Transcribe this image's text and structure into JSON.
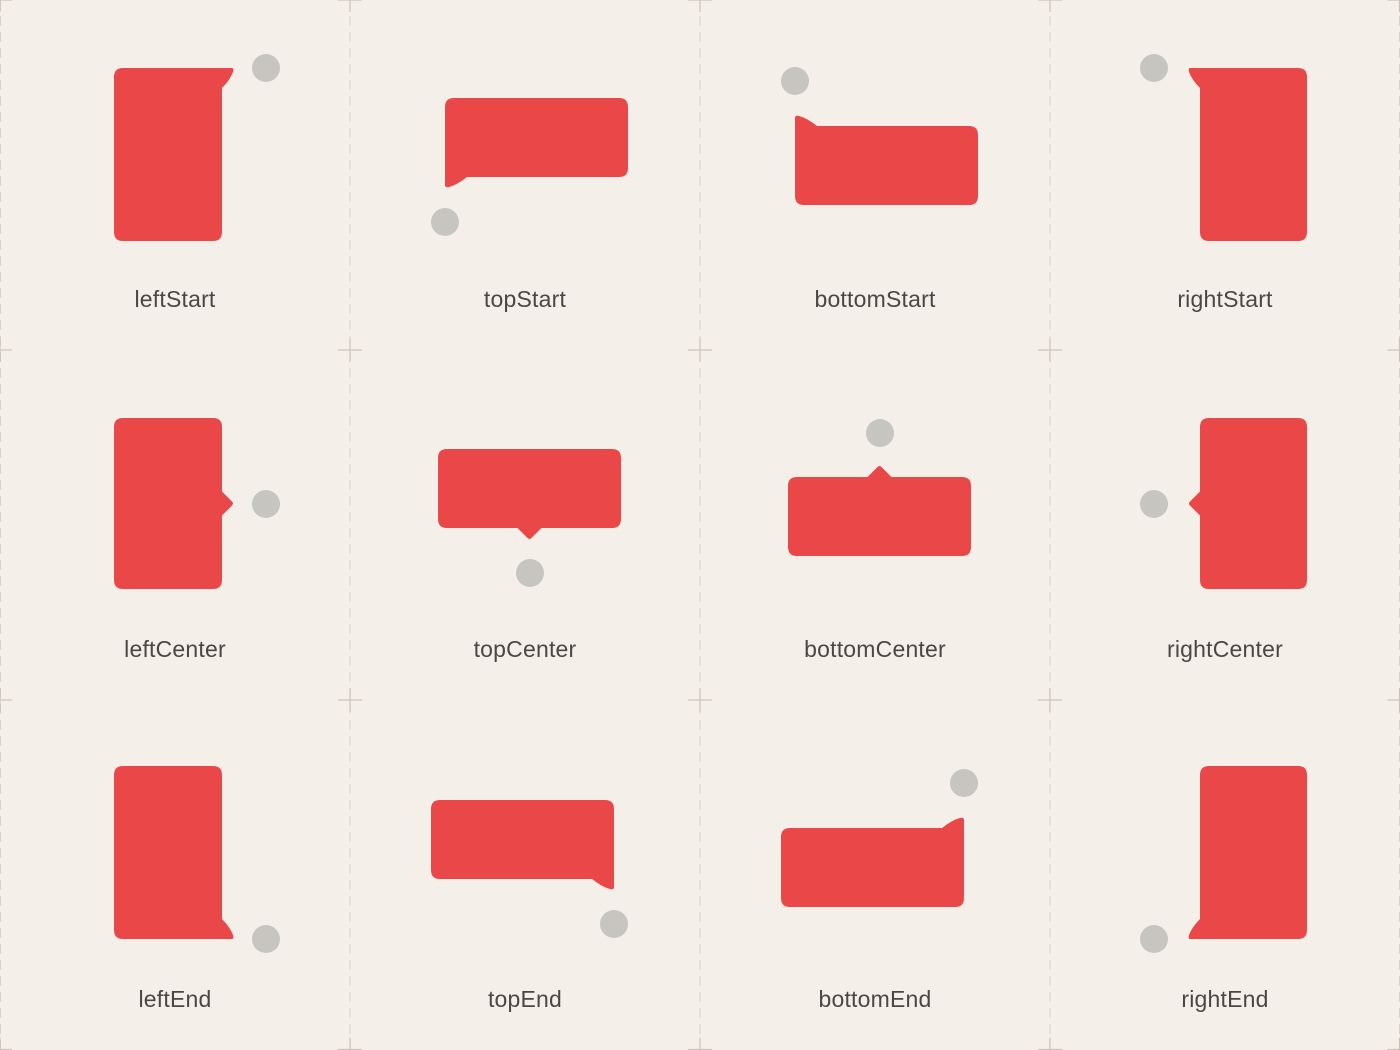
{
  "colors": {
    "background": "#f4efe8",
    "tooltip": "#ea4848",
    "anchor": "#c6c5c0",
    "grid": "#d6d1ca",
    "label": "#4a4744"
  },
  "grid": {
    "columns": 4,
    "rows": 3
  },
  "cells": [
    {
      "label": "leftStart",
      "side": "left",
      "align": "start",
      "shape": "tall"
    },
    {
      "label": "topStart",
      "side": "top",
      "align": "start",
      "shape": "wide"
    },
    {
      "label": "bottomStart",
      "side": "bottom",
      "align": "start",
      "shape": "wide"
    },
    {
      "label": "rightStart",
      "side": "right",
      "align": "start",
      "shape": "tall"
    },
    {
      "label": "leftCenter",
      "side": "left",
      "align": "center",
      "shape": "tall"
    },
    {
      "label": "topCenter",
      "side": "top",
      "align": "center",
      "shape": "wide"
    },
    {
      "label": "bottomCenter",
      "side": "bottom",
      "align": "center",
      "shape": "wide"
    },
    {
      "label": "rightCenter",
      "side": "right",
      "align": "center",
      "shape": "tall"
    },
    {
      "label": "leftEnd",
      "side": "left",
      "align": "end",
      "shape": "tall"
    },
    {
      "label": "topEnd",
      "side": "top",
      "align": "end",
      "shape": "wide"
    },
    {
      "label": "bottomEnd",
      "side": "bottom",
      "align": "end",
      "shape": "wide"
    },
    {
      "label": "rightEnd",
      "side": "right",
      "align": "end",
      "shape": "tall"
    }
  ]
}
